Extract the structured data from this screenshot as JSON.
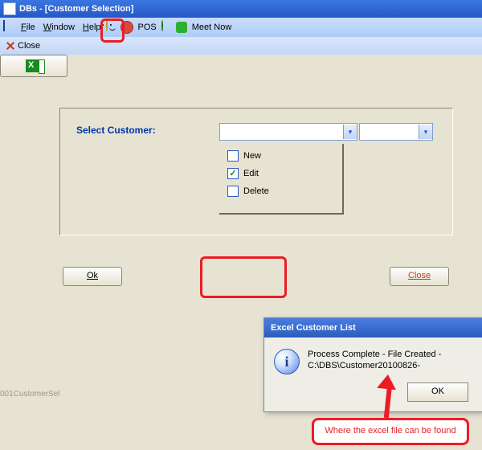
{
  "title": "DBs - [Customer Selection]",
  "menu": {
    "file": "File",
    "window": "Window",
    "help": "Help",
    "pos": "POS",
    "meetnow": "Meet Now"
  },
  "toolbar": {
    "close": "Close"
  },
  "form": {
    "select_label": "Select Customer:",
    "combo1_value": "",
    "combo2_value": "",
    "opt_new": "New",
    "opt_edit": "Edit",
    "opt_delete": "Delete"
  },
  "buttons": {
    "ok": "Ok",
    "close": "Close"
  },
  "dialog": {
    "title": "Excel Customer List",
    "message": "Process Complete - File Created - C:\\DBS\\Customer20100826-",
    "ok": "OK"
  },
  "callout": "Where the excel file can be found",
  "status": "001CustomerSel"
}
